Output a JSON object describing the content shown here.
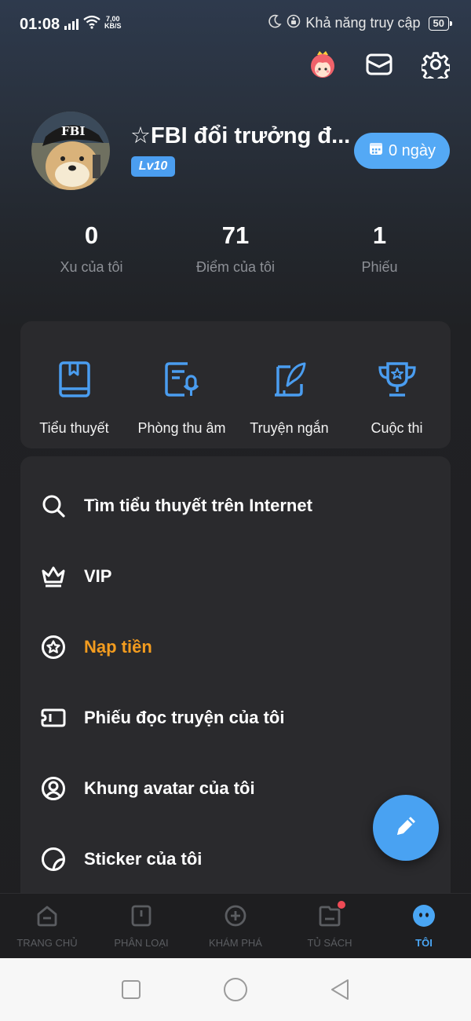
{
  "status_bar": {
    "time": "01:08",
    "net_speed_value": "7,00",
    "net_speed_unit": "KB/S",
    "accessibility_label": "Khả năng truy cập",
    "battery": "50"
  },
  "profile": {
    "username": "☆FBI đổi trưởng đ...",
    "level": "Lv10",
    "checkin_label": "0 ngày"
  },
  "stats": [
    {
      "value": "0",
      "label": "Xu của tôi"
    },
    {
      "value": "71",
      "label": "Điểm của tôi"
    },
    {
      "value": "1",
      "label": "Phiếu"
    }
  ],
  "features": [
    {
      "label": "Tiểu thuyết",
      "icon": "book-icon"
    },
    {
      "label": "Phòng thu âm",
      "icon": "recording-icon"
    },
    {
      "label": "Truyện ngắn",
      "icon": "quill-icon"
    },
    {
      "label": "Cuộc thi",
      "icon": "trophy-icon"
    }
  ],
  "menu": [
    {
      "label": "Tìm tiểu thuyết trên Internet",
      "icon": "search-icon"
    },
    {
      "label": "VIP",
      "icon": "crown-icon"
    },
    {
      "label": "Nạp tiền",
      "icon": "star-circle-icon",
      "highlight_color": "#f39c1f"
    },
    {
      "label": "Phiếu đọc truyện của tôi",
      "icon": "ticket-icon"
    },
    {
      "label": "Khung avatar của tôi",
      "icon": "avatar-frame-icon"
    },
    {
      "label": "Sticker của tôi",
      "icon": "sticker-icon"
    }
  ],
  "tabs": [
    {
      "label": "TRANG CHỦ",
      "icon": "home-icon"
    },
    {
      "label": "PHÂN LOẠI",
      "icon": "category-icon"
    },
    {
      "label": "KHÁM PHÁ",
      "icon": "explore-icon"
    },
    {
      "label": "TỦ SÁCH",
      "icon": "bookshelf-icon",
      "has_badge": true
    },
    {
      "label": "TÔI",
      "icon": "me-icon",
      "active": true
    }
  ],
  "colors": {
    "accent": "#4aa6f4",
    "highlight": "#f39c1f",
    "badge": "#ef4a55"
  }
}
